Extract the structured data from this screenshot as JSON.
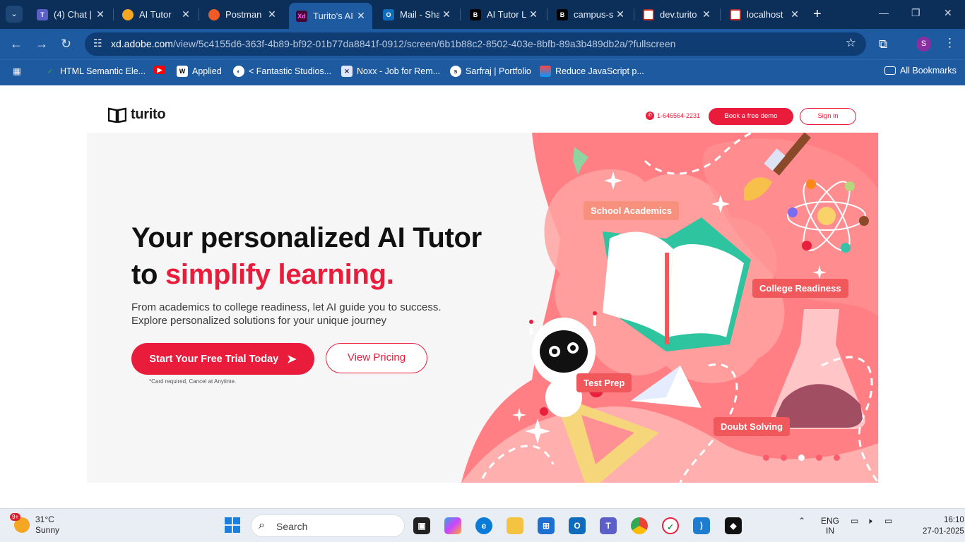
{
  "browser": {
    "tabs": [
      {
        "title": "(4) Chat |",
        "favicon_color": "#5b5fc7"
      },
      {
        "title": "AI Tutor",
        "favicon_color": "#f5a623"
      },
      {
        "title": "Postman",
        "favicon_color": "#ef5b25"
      },
      {
        "title": "Turito's AI",
        "favicon_color": "#470137",
        "active": true
      },
      {
        "title": "Mail - Sha",
        "favicon_color": "#0f6cbd"
      },
      {
        "title": "AI Tutor L",
        "favicon_color": "#000000"
      },
      {
        "title": "campus-s",
        "favicon_color": "#000000"
      },
      {
        "title": "dev.turito",
        "favicon_color": "#ffffff"
      },
      {
        "title": "localhost",
        "favicon_color": "#ffffff"
      }
    ],
    "url_host": "xd.adobe.com",
    "url_rest": "/view/5c4155d6-363f-4b89-bf92-01b77da8841f-0912/screen/6b1b88c2-8502-403e-8bfb-89a3b489db2a/?fullscreen",
    "profile_initial": "S",
    "bookmarks": [
      {
        "label": "HTML Semantic Ele...",
        "icon": "w3-icon"
      },
      {
        "label": "",
        "icon": "youtube-icon"
      },
      {
        "label": "Applied",
        "icon": "applied-icon"
      },
      {
        "label": "< Fantastic Studios...",
        "icon": "globe-icon"
      },
      {
        "label": "Noxx - Job for Rem...",
        "icon": "noxx-icon"
      },
      {
        "label": "Sarfraj | Portfolio",
        "icon": "portfolio-icon"
      },
      {
        "label": "Reduce JavaScript p...",
        "icon": "lighthouse-icon"
      }
    ],
    "all_bookmarks": "All Bookmarks"
  },
  "site": {
    "logo_text": "turito",
    "phone": "1-646564-2231",
    "demo_label": "Book a free demo",
    "signin_label": "Sign in",
    "hero_line1": "Your personalized AI Tutor",
    "hero_line2_prefix": "to ",
    "hero_line2_highlight": "simplify learning.",
    "hero_sub_1": "From academics to college readiness, let AI guide you to success.",
    "hero_sub_2": "Explore personalized solutions for your unique journey",
    "trial_label": "Start Your Free Trial Today",
    "pricing_label": "View Pricing",
    "note": "*Card required, Cancel at Anytime.",
    "pills": {
      "academics": "School Academics",
      "college": "College Readiness",
      "test_prep": "Test Prep",
      "doubt": "Doubt Solving"
    },
    "carousel": {
      "count": 5,
      "active_index": 3
    },
    "colors": {
      "brand_red": "#ea1c3b",
      "art_pink": "#ff7f84"
    }
  },
  "taskbar": {
    "temperature": "31°C",
    "condition": "Sunny",
    "badge": "9+",
    "search_placeholder": "Search",
    "lang_1": "ENG",
    "lang_2": "IN",
    "time": "16:10",
    "date": "27-01-2025"
  }
}
